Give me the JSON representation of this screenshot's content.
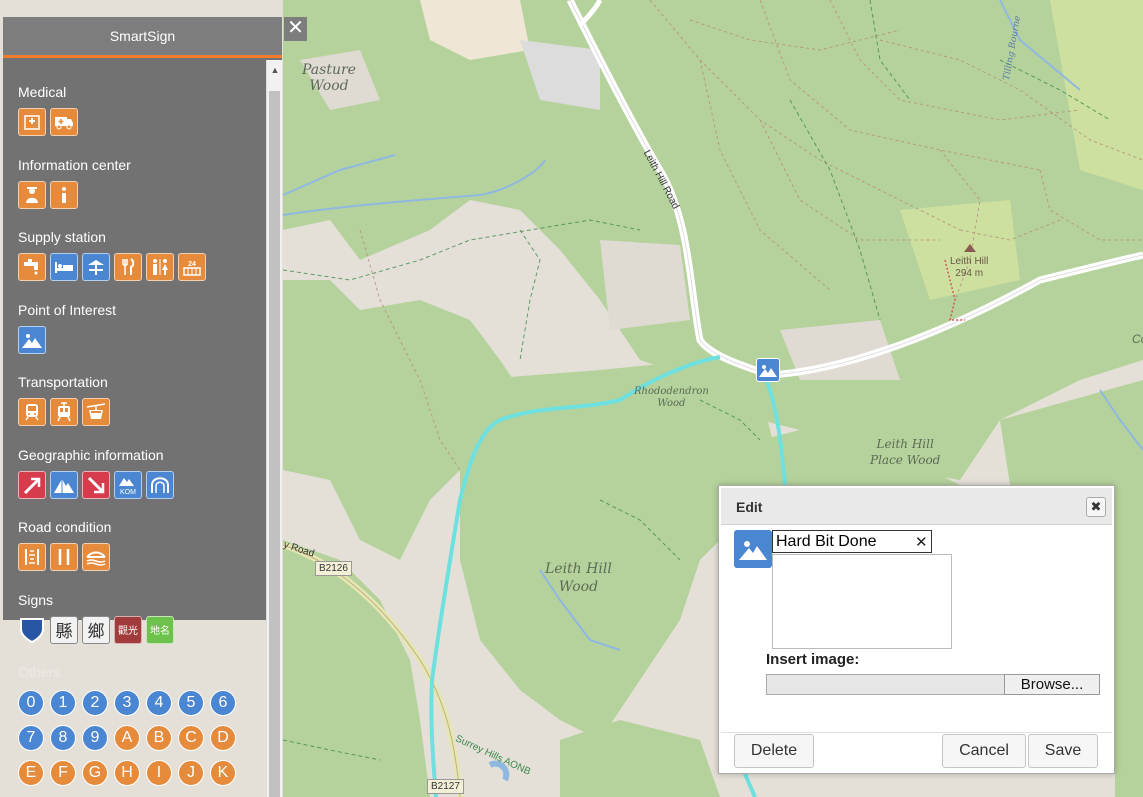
{
  "map": {
    "labels": {
      "pasture_wood": "Pasture\nWood",
      "leith_hill_road": "Leith Hill Road",
      "rhododendron_wood": "Rhododendron\nWood",
      "leith_hill_place_wood": "Leith Hill\nPlace Wood",
      "leith_hill_wood": "Leith Hill\nWood",
      "leith_hill_peak": "Leith Hill\n294 m",
      "b2126": "B2126",
      "b2127": "B2127",
      "surrey_hills": "Surrey Hills AONB",
      "road_left": "y Road",
      "tilling_bourne": "Tilling Bourne",
      "co": "Co"
    }
  },
  "sidebar": {
    "title": "SmartSign",
    "close_symbol": "✕",
    "categories": [
      {
        "title": "Medical",
        "icons": [
          "hospital-icon",
          "ambulance-icon"
        ]
      },
      {
        "title": "Information center",
        "icons": [
          "information-staff-icon",
          "information-icon"
        ]
      },
      {
        "title": "Supply station",
        "icons": [
          "water-tap-icon",
          "bed-icon",
          "picnic-shelter-icon",
          "restaurant-icon",
          "restroom-icon",
          "24h-store-icon"
        ]
      },
      {
        "title": "Point of Interest",
        "icons": [
          "mountain-view-icon"
        ]
      },
      {
        "title": "Transportation",
        "icons": [
          "train-icon",
          "tram-icon",
          "cable-car-icon"
        ]
      },
      {
        "title": "Geographic information",
        "icons": [
          "uphill-icon",
          "peak-icon",
          "downhill-icon",
          "kom-icon",
          "tunnel-icon"
        ]
      },
      {
        "title": "Road condition",
        "icons": [
          "rough-road-icon",
          "narrow-road-icon",
          "bridge-icon"
        ]
      },
      {
        "title": "Signs",
        "icons": [
          "shield-sign-icon",
          "county-sign-icon",
          "township-sign-icon",
          "tourism-sign-icon",
          "place-name-sign-icon"
        ]
      }
    ],
    "signs_text": {
      "county": "縣",
      "township": "鄉",
      "tourism": "觀光",
      "placename": "地名"
    },
    "kom_text": "KOM",
    "others": {
      "title": "Others",
      "row1": [
        "0",
        "1",
        "2",
        "3",
        "4",
        "5",
        "6"
      ],
      "row2": [
        "7",
        "8",
        "9",
        "A",
        "B",
        "C",
        "D"
      ],
      "row3": [
        "E",
        "F",
        "G",
        "H",
        "I",
        "J",
        "K"
      ]
    }
  },
  "dialog": {
    "title": "Edit",
    "close_symbol": "✖",
    "name_value": "Hard Bit Done",
    "clear_symbol": "✕",
    "insert_image_label": "Insert image:",
    "browse_label": "Browse...",
    "delete_label": "Delete",
    "cancel_label": "Cancel",
    "save_label": "Save"
  },
  "colors": {
    "accent": "#f07d2d",
    "icon_orange": "#e58b3b",
    "icon_blue": "#4a86d2",
    "icon_red": "#d63c4c",
    "route": "#6ee0df"
  }
}
